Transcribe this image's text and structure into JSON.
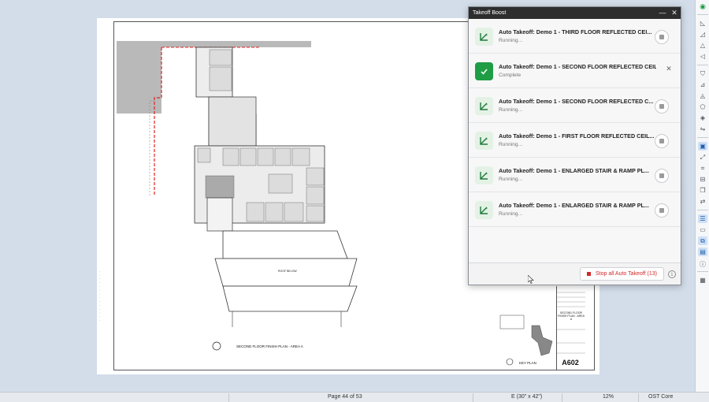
{
  "panel": {
    "title": "Takeoff Boost",
    "tasks": [
      {
        "title": "Auto Takeoff: Demo 1 - THIRD FLOOR REFLECTED CEI...",
        "status": "Running...",
        "state": "running"
      },
      {
        "title": "Auto Takeoff: Demo 1 - SECOND FLOOR REFLECTED CEILI...",
        "status": "Complete",
        "state": "complete"
      },
      {
        "title": "Auto Takeoff: Demo 1 - SECOND FLOOR REFLECTED C...",
        "status": "Running...",
        "state": "running"
      },
      {
        "title": "Auto Takeoff: Demo 1 - FIRST FLOOR REFLECTED CEIL...",
        "status": "Running...",
        "state": "running"
      },
      {
        "title": "Auto Takeoff: Demo 1 - ENLARGED STAIR & RAMP PL...",
        "status": "Running...",
        "state": "running"
      },
      {
        "title": "Auto Takeoff: Demo 1 - ENLARGED STAIR & RAMP PL...",
        "status": "Running...",
        "state": "running"
      }
    ],
    "stop_all_label": "Stop all Auto Takeoff (13)",
    "icons": {
      "task": "takeoff-icon",
      "complete": "check-icon",
      "stop": "stop-icon",
      "close": "close-icon",
      "minimize": "minimize-icon",
      "info": "info-icon"
    },
    "colors": {
      "complete": "#1f9d45",
      "stop_all": "#d12a2a",
      "titlebar": "#2d2d2d"
    }
  },
  "sheet": {
    "plan_caption": "SECOND FLOOR FINISH PLAN - AREA A",
    "key_caption": "KEY PLAN",
    "sheet_title": "SECOND FLOOR FINISH PLAN - AREA A",
    "sheet_number": "A602",
    "roof_label": "ROOF BELOW"
  },
  "status_bar": {
    "page": "Page 44 of 53",
    "size": "E (30\" x 42\")",
    "zoom": "12%",
    "product": "OST Core"
  }
}
